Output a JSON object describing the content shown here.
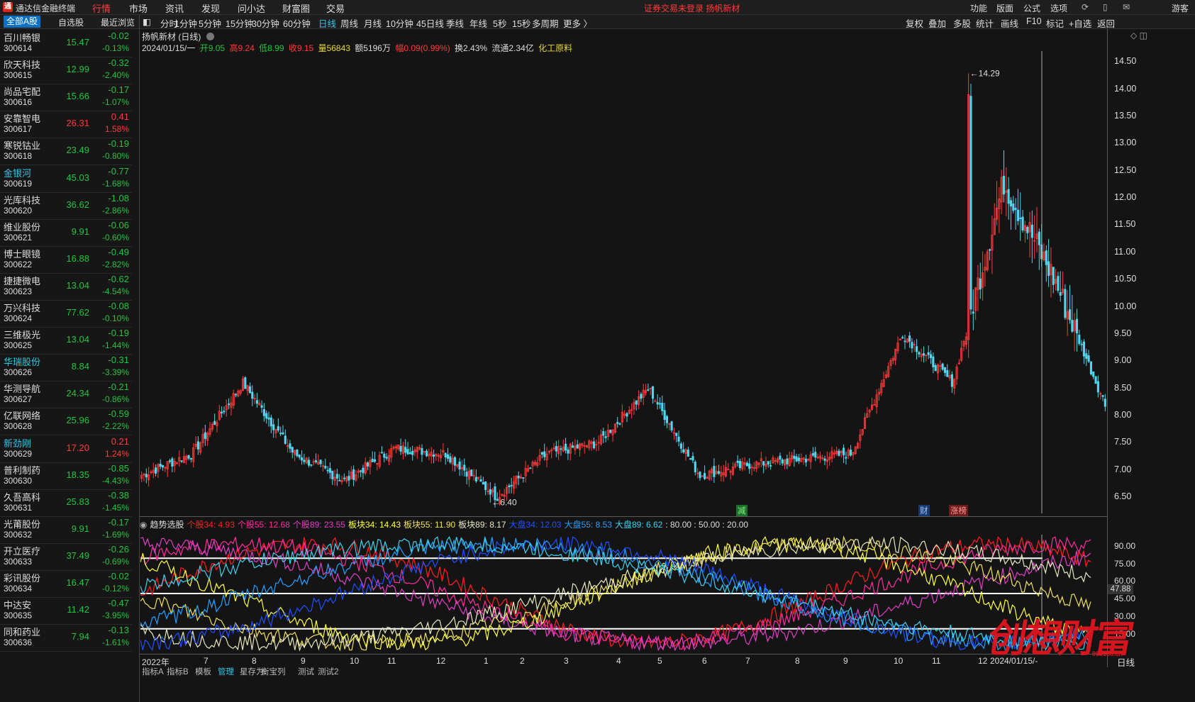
{
  "app": {
    "title": "通达信金融终端",
    "login_warning": "证券交易未登录  扬帆新材"
  },
  "main_menu": [
    "行情",
    "市场",
    "资讯",
    "发现",
    "问小达",
    "财富圈",
    "交易"
  ],
  "right_menu": [
    "功能",
    "版面",
    "公式",
    "选项"
  ],
  "user_label": "游客",
  "list_tabs": [
    "全部A股",
    "自选股",
    "最近浏览"
  ],
  "stocks": [
    {
      "name": "百川畅银",
      "code": "300614",
      "price": "15.47",
      "chg": "-0.02",
      "pct": "-0.13%",
      "dir": "dn"
    },
    {
      "name": "欣天科技",
      "code": "300615",
      "price": "12.99",
      "chg": "-0.32",
      "pct": "-2.40%",
      "dir": "dn"
    },
    {
      "name": "尚品宅配",
      "code": "300616",
      "price": "15.66",
      "chg": "-0.17",
      "pct": "-1.07%",
      "dir": "dn"
    },
    {
      "name": "安靠智电",
      "code": "300617",
      "price": "26.31",
      "chg": "0.41",
      "pct": "1.58%",
      "dir": "up"
    },
    {
      "name": "寒锐钴业",
      "code": "300618",
      "price": "23.49",
      "chg": "-0.19",
      "pct": "-0.80%",
      "dir": "dn"
    },
    {
      "name": "金银河",
      "code": "300619",
      "price": "45.03",
      "chg": "-0.77",
      "pct": "-1.68%",
      "dir": "dn",
      "hl": true
    },
    {
      "name": "光库科技",
      "code": "300620",
      "price": "36.62",
      "chg": "-1.08",
      "pct": "-2.86%",
      "dir": "dn"
    },
    {
      "name": "维业股份",
      "code": "300621",
      "price": "9.91",
      "chg": "-0.06",
      "pct": "-0.60%",
      "dir": "dn"
    },
    {
      "name": "博士眼镜",
      "code": "300622",
      "price": "16.88",
      "chg": "-0.49",
      "pct": "-2.82%",
      "dir": "dn"
    },
    {
      "name": "捷捷微电",
      "code": "300623",
      "price": "13.04",
      "chg": "-0.62",
      "pct": "-4.54%",
      "dir": "dn"
    },
    {
      "name": "万兴科技",
      "code": "300624",
      "price": "77.62",
      "chg": "-0.08",
      "pct": "-0.10%",
      "dir": "dn"
    },
    {
      "name": "三维极光",
      "code": "300625",
      "price": "13.04",
      "chg": "-0.19",
      "pct": "-1.44%",
      "dir": "dn"
    },
    {
      "name": "华瑞股份",
      "code": "300626",
      "price": "8.84",
      "chg": "-0.31",
      "pct": "-3.39%",
      "dir": "dn",
      "hl": true
    },
    {
      "name": "华测导航",
      "code": "300627",
      "price": "24.34",
      "chg": "-0.21",
      "pct": "-0.86%",
      "dir": "dn"
    },
    {
      "name": "亿联网络",
      "code": "300628",
      "price": "25.96",
      "chg": "-0.59",
      "pct": "-2.22%",
      "dir": "dn"
    },
    {
      "name": "新劲刚",
      "code": "300629",
      "price": "17.20",
      "chg": "0.21",
      "pct": "1.24%",
      "dir": "up",
      "hl": true
    },
    {
      "name": "普利制药",
      "code": "300630",
      "price": "18.35",
      "chg": "-0.85",
      "pct": "-4.43%",
      "dir": "dn"
    },
    {
      "name": "久吾高科",
      "code": "300631",
      "price": "25.83",
      "chg": "-0.38",
      "pct": "-1.45%",
      "dir": "dn"
    },
    {
      "name": "光莆股份",
      "code": "300632",
      "price": "9.91",
      "chg": "-0.17",
      "pct": "-1.69%",
      "dir": "dn"
    },
    {
      "name": "开立医疗",
      "code": "300633",
      "price": "37.49",
      "chg": "-0.26",
      "pct": "-0.69%",
      "dir": "dn"
    },
    {
      "name": "彩讯股份",
      "code": "300634",
      "price": "16.47",
      "chg": "-0.02",
      "pct": "-0.12%",
      "dir": "dn"
    },
    {
      "name": "中达安",
      "code": "300635",
      "price": "11.42",
      "chg": "-0.47",
      "pct": "-3.95%",
      "dir": "dn"
    },
    {
      "name": "同和药业",
      "code": "300636",
      "price": "7.94",
      "chg": "-0.13",
      "pct": "-1.61%",
      "dir": "dn"
    }
  ],
  "periods": [
    "分时",
    "1分钟",
    "5分钟",
    "15分钟",
    "30分钟",
    "60分钟",
    "日线",
    "周线",
    "月线",
    "10分钟",
    "45日线",
    "季线",
    "年线",
    "5秒",
    "15秒",
    "多周期",
    "更多 〉"
  ],
  "active_period": "日线",
  "right_buttons": [
    "复权",
    "叠加",
    "多股",
    "统计",
    "画线",
    "F10",
    "标记",
    "+自选",
    "返回"
  ],
  "chart": {
    "title": "扬帆新材 (日线)",
    "info": {
      "date": "2024/01/15/一",
      "open": "开9.05",
      "high": "高9.24",
      "low": "低8.99",
      "close": "收9.15",
      "vol": "量56843",
      "amount": "额5196万",
      "range": "幅0.09(0.99%)",
      "turnover": "换2.43%",
      "float": "流通2.34亿",
      "sector": "化工原料"
    },
    "max_label": "14.29",
    "min_label": "6.40",
    "annotations": [
      "减",
      "财",
      "涨榜"
    ],
    "y_ticks": [
      "14.50",
      "14.00",
      "13.50",
      "13.00",
      "12.50",
      "12.00",
      "11.50",
      "11.00",
      "10.50",
      "10.00",
      "9.50",
      "9.00",
      "8.50",
      "8.00",
      "7.50",
      "7.00",
      "6.50"
    ],
    "x_labels": [
      "2022年",
      "7",
      "8",
      "9",
      "10",
      "11",
      "12",
      "1",
      "2",
      "3",
      "4",
      "5",
      "6",
      "7",
      "8",
      "9",
      "10",
      "11",
      "12",
      "2024/01/15/-"
    ],
    "period_label": "日线",
    "colors": {
      "up": "#ff3b3b",
      "down": "#52d6ee"
    }
  },
  "chart_data": [
    {
      "type": "candlestick",
      "title": "扬帆新材 (日线)",
      "x": [
        "2022-06",
        "2022-07",
        "2022-08",
        "2022-09",
        "2022-10",
        "2022-11",
        "2022-12",
        "2023-01",
        "2023-02",
        "2023-03",
        "2023-04",
        "2023-05",
        "2023-06",
        "2023-07",
        "2023-08",
        "2023-09",
        "2023-10",
        "2023-11",
        "2023-12",
        "2024-01"
      ],
      "close_path": [
        6.9,
        7.3,
        8.6,
        7.3,
        6.8,
        7.4,
        7.3,
        6.5,
        7.3,
        7.5,
        8.5,
        6.9,
        7.1,
        7.2,
        7.3,
        9.5,
        8.6,
        12.3,
        10.5,
        8.2
      ],
      "ylim": [
        6.2,
        14.7
      ],
      "max": 14.29,
      "min": 6.4
    },
    {
      "type": "line",
      "title": "趋势选股",
      "series": [
        {
          "name": "个股34",
          "value": "4.93",
          "color": "#ff2020"
        },
        {
          "name": "个股55",
          "value": "12.68",
          "color": "#ff2ea0"
        },
        {
          "name": "个股89",
          "value": "23.55",
          "color": "#e040c8"
        },
        {
          "name": "板块34",
          "value": "14.43",
          "color": "#ffff40"
        },
        {
          "name": "板块55",
          "value": "11.90",
          "color": "#f0e060"
        },
        {
          "name": "板块89",
          "value": "8.17",
          "color": "#e8e8c0"
        },
        {
          "name": "大盘34",
          "value": "12.03",
          "color": "#2050ff"
        },
        {
          "name": "大盘55",
          "value": "8.53",
          "color": "#28a0ff"
        },
        {
          "name": "大盘89",
          "value": "6.62",
          "color": "#40d0f0"
        }
      ],
      "levels": [
        "80.00",
        "50.00",
        "20.00"
      ],
      "ylim": [
        0,
        100
      ],
      "y_ticks": [
        "90.00",
        "75.00",
        "60.00",
        "45.00",
        "30.00",
        "15.00"
      ],
      "current": "47.88"
    }
  ],
  "bottom_tabs": [
    "指标A",
    "指标B",
    "模板",
    "管理",
    "星存为",
    "衡宝列",
    "测试",
    "测试2"
  ],
  "active_bottom_tab": "管理",
  "watermark": {
    "text": "创想财富",
    "url": "995168.cn"
  }
}
